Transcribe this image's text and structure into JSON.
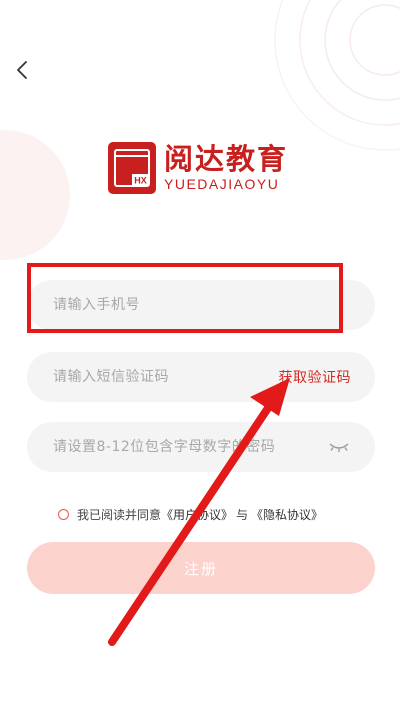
{
  "header": {
    "back_icon": "chevron-left-icon"
  },
  "logo": {
    "mark_text": "HX",
    "name_cn": "阅达教育",
    "name_en": "YUEDAJIAOYU"
  },
  "form": {
    "phone_placeholder": "请输入手机号",
    "code_placeholder": "请输入短信验证码",
    "get_code_label": "获取验证码",
    "password_placeholder": "请设置8-12位包含字母数字的密码",
    "password_toggle_icon": "eye-closed-icon"
  },
  "agreement": {
    "prefix": "我已阅读并同意",
    "user_agreement": "《用户协议》",
    "conjunction": "与",
    "privacy_policy": "《隐私协议》"
  },
  "register_label": "注册",
  "colors": {
    "brand": "#c8201e",
    "highlight": "#e21a1a",
    "register_bg": "#fcd2cd",
    "field_bg": "#f4f4f4"
  }
}
